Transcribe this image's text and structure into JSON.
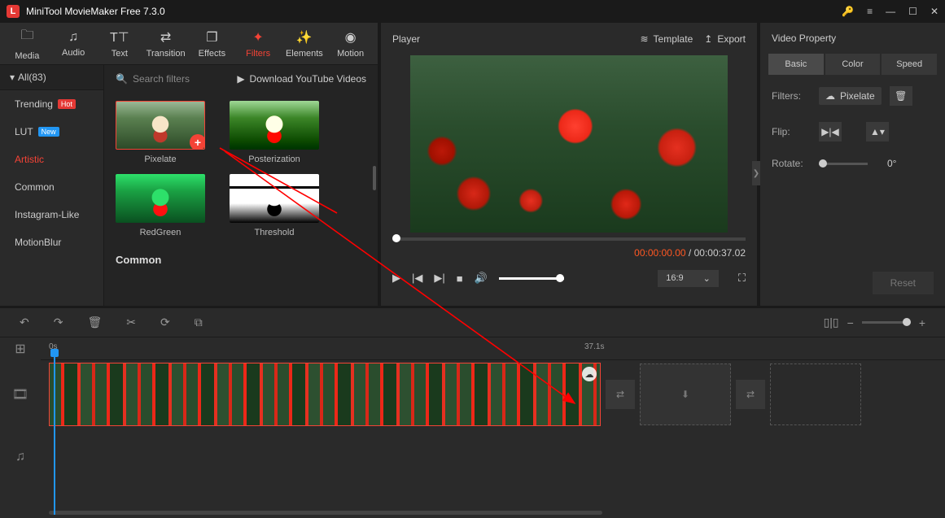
{
  "app": {
    "title": "MiniTool MovieMaker Free 7.3.0"
  },
  "toolbar": {
    "tabs": [
      {
        "icon": "folder",
        "label": "Media"
      },
      {
        "icon": "note",
        "label": "Audio"
      },
      {
        "icon": "text",
        "label": "Text"
      },
      {
        "icon": "swap",
        "label": "Transition"
      },
      {
        "icon": "layers",
        "label": "Effects"
      },
      {
        "icon": "blob",
        "label": "Filters"
      },
      {
        "icon": "sparkle",
        "label": "Elements"
      },
      {
        "icon": "circle",
        "label": "Motion"
      }
    ],
    "active": "Filters"
  },
  "filters": {
    "all_label": "All(83)",
    "categories": [
      {
        "label": "Trending",
        "badge": "Hot"
      },
      {
        "label": "LUT",
        "badge": "New"
      },
      {
        "label": "Artistic",
        "active": true
      },
      {
        "label": "Common"
      },
      {
        "label": "Instagram-Like"
      },
      {
        "label": "MotionBlur"
      }
    ],
    "search_placeholder": "Search filters",
    "download_label": "Download YouTube Videos",
    "items": {
      "pixelate": "Pixelate",
      "posterization": "Posterization",
      "redgreen": "RedGreen",
      "threshold": "Threshold"
    },
    "section_common": "Common"
  },
  "player": {
    "title": "Player",
    "template_label": "Template",
    "export_label": "Export",
    "time_current": "00:00:00.00",
    "time_total": "00:00:37.02",
    "time_sep": " / ",
    "aspect": "16:9"
  },
  "props": {
    "title": "Video Property",
    "tabs": {
      "basic": "Basic",
      "color": "Color",
      "speed": "Speed"
    },
    "filters_label": "Filters:",
    "filter_name": "Pixelate",
    "flip_label": "Flip:",
    "rotate_label": "Rotate:",
    "rotate_value": "0°",
    "reset_label": "Reset"
  },
  "timeline": {
    "start_label": "0s",
    "end_label": "37.1s"
  }
}
